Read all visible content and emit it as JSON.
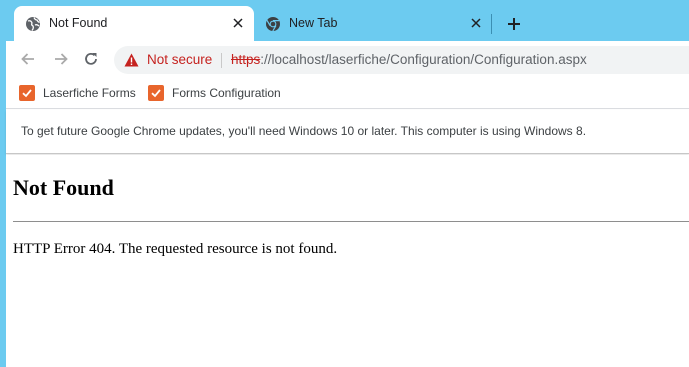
{
  "colors": {
    "frame": "#6ccbf0",
    "not_secure": "#c5221f",
    "bookmark_check": "#e8652c"
  },
  "tabs": [
    {
      "label": "Not Found",
      "icon": "globe-icon",
      "active": true
    },
    {
      "label": "New Tab",
      "icon": "chrome-icon",
      "active": false
    }
  ],
  "toolbar": {
    "security_label": "Not secure",
    "url_scheme": "https",
    "url_rest": "://localhost/laserfiche/Configuration/Configuration.aspx"
  },
  "bookmarks": [
    {
      "label": "Laserfiche Forms",
      "icon": "checkbox-icon"
    },
    {
      "label": "Forms Configuration",
      "icon": "checkbox-icon"
    }
  ],
  "infobar": {
    "message": "To get future Google Chrome updates, you'll need Windows 10 or later. This computer is using Windows 8."
  },
  "page": {
    "heading": "Not Found",
    "error_text": "HTTP Error 404. The requested resource is not found."
  }
}
